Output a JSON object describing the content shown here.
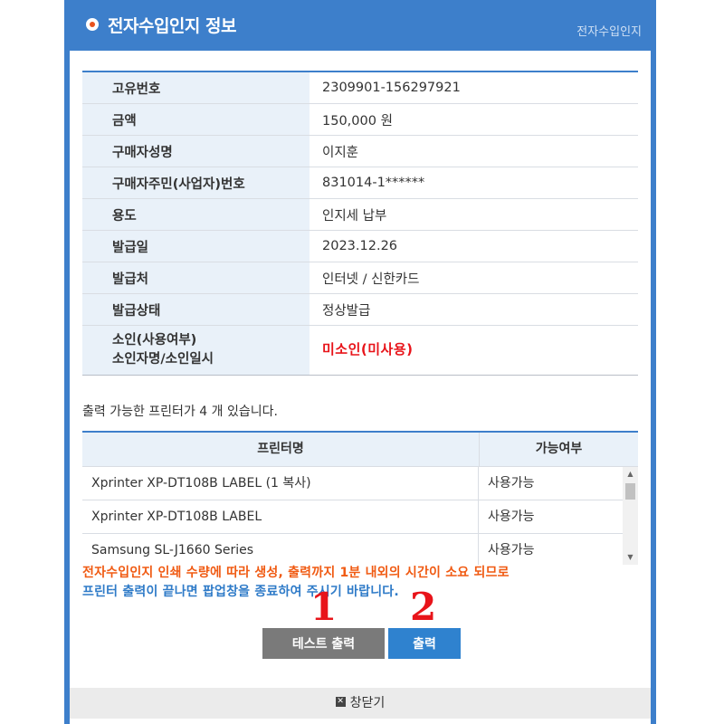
{
  "header": {
    "title": "전자수입인지 정보",
    "right_label": "전자수입인지"
  },
  "info": [
    {
      "label": "고유번호",
      "value": "2309901-156297921"
    },
    {
      "label": "금액",
      "value": "150,000 원"
    },
    {
      "label": "구매자성명",
      "value": "이지훈"
    },
    {
      "label": "구매자주민(사업자)번호",
      "value": "831014-1******"
    },
    {
      "label": "용도",
      "value": "인지세 납부"
    },
    {
      "label": "발급일",
      "value": "2023.12.26"
    },
    {
      "label": "발급처",
      "value": "인터넷 / 신한카드"
    },
    {
      "label": "발급상태",
      "value": "정상발급"
    }
  ],
  "usage": {
    "label_line1": "소인(사용여부)",
    "label_line2": "소인자명/소인일시",
    "value": "미소인(미사용)",
    "value_color": "#e8141a"
  },
  "printer_count_text": "출력 가능한 프린터가 4 개 있습니다.",
  "printers": {
    "headers": [
      "프린터명",
      "가능여부"
    ],
    "rows": [
      {
        "name": "Xprinter XP-DT108B LABEL (1 복사)",
        "status": "사용가능"
      },
      {
        "name": "Xprinter XP-DT108B LABEL",
        "status": "사용가능"
      },
      {
        "name": "Samsung SL-J1660 Series",
        "status": "사용가능"
      }
    ]
  },
  "notice": {
    "line1": "전자수입인지 인쇄 수량에 따라 생성, 출력까지 1분 내외의 시간이 소요 되므로",
    "line2": "프린터 출력이 끝나면 팝업창을 종료하여 주시기 바랍니다.",
    "line1_color": "#f05a12",
    "line2_color": "#2f7bc8"
  },
  "annotations": {
    "one": "1",
    "two": "2"
  },
  "buttons": {
    "test_print": "테스트 출력",
    "print": "출력"
  },
  "footer": {
    "close_label": "창닫기"
  },
  "colors": {
    "accent": "#3d7fcb",
    "header_bg": "#e9f1f9"
  }
}
